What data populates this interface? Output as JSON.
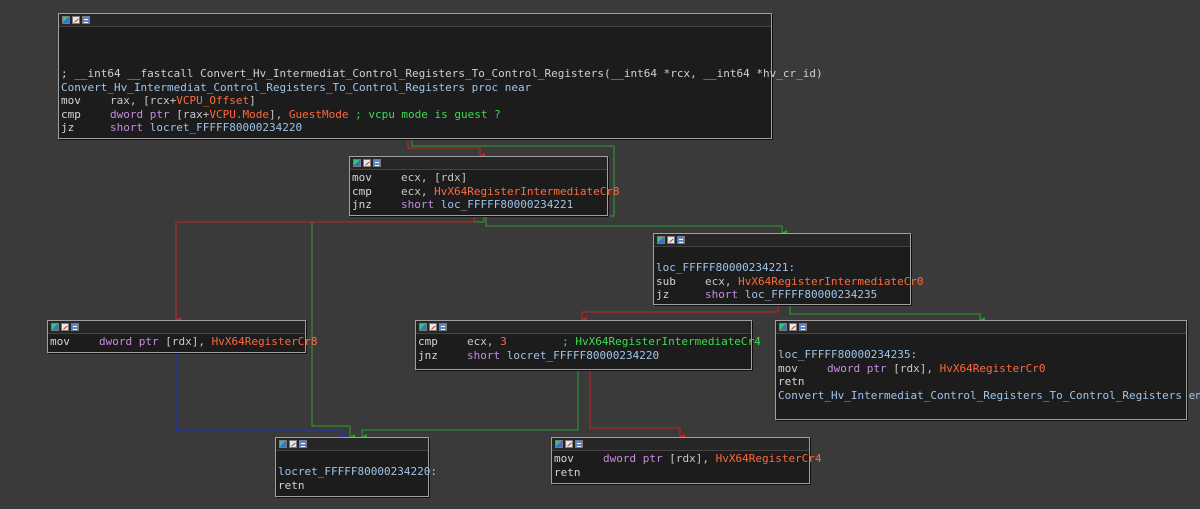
{
  "colors": {
    "background": "#3a3a3a",
    "node_bg": "#1c1c1c",
    "edge_true": "#2e9d2e",
    "edge_false": "#cc2222",
    "edge_uncond": "#2233cc",
    "symbol_orange": "#ff6a3d",
    "keyword_purple": "#c78be0",
    "comment_green": "#3cdc55",
    "label_blue": "#9fc4e8"
  },
  "header_icons": [
    "graph-overview-icon",
    "edit-node-icon",
    "node-list-icon"
  ],
  "nodes": {
    "entry": {
      "comment": "; __int64 __fastcall Convert_Hv_Intermediat_Control_Registers_To_Control_Registers(__int64 *rcx, __int64 *hv_cr_id)",
      "proc_line": "Convert_Hv_Intermediat_Control_Registers_To_Control_Registers proc near",
      "i1": {
        "mnem": "mov",
        "op_a": "rax, [rcx+",
        "sym": "VCPU_Offset",
        "op_b": "]"
      },
      "i2": {
        "mnem": "cmp",
        "kw": "dword ptr",
        "op_a": " [rax+",
        "sym": "VCPU.Mode",
        "op_b": "], ",
        "sym2": "GuestMode",
        "comment": " ; vcpu mode is guest ?"
      },
      "i3": {
        "mnem": "jz",
        "kw": "short",
        "target": " locret_FFFFF80000234220"
      }
    },
    "check_cr8": {
      "i1": {
        "mnem": "mov",
        "op": "ecx, [rdx]"
      },
      "i2": {
        "mnem": "cmp",
        "op": "ecx, ",
        "sym": "HvX64RegisterIntermediateCr8"
      },
      "i3": {
        "mnem": "jnz",
        "kw": "short",
        "target": " loc_FFFFF80000234221"
      }
    },
    "loc_221": {
      "label": "loc_FFFFF80000234221:",
      "i1": {
        "mnem": "sub",
        "op": "ecx, ",
        "sym": "HvX64RegisterIntermediateCr0"
      },
      "i2": {
        "mnem": "jz",
        "kw": "short",
        "target": " loc_FFFFF80000234235"
      }
    },
    "set_cr8": {
      "i1": {
        "mnem": "mov",
        "kw": "dword ptr",
        "op": " [rdx], ",
        "sym": "HvX64RegisterCr8"
      }
    },
    "check_cr4": {
      "i1": {
        "mnem": "cmp",
        "op": "ecx, ",
        "num": "3",
        "comment": "; HvX64RegisterIntermediateCr4"
      },
      "i2": {
        "mnem": "jnz",
        "kw": "short",
        "target": " locret_FFFFF80000234220"
      }
    },
    "loc_235": {
      "label": "loc_FFFFF80000234235:",
      "i1": {
        "mnem": "mov",
        "kw": "dword ptr",
        "op": " [rdx], ",
        "sym": "HvX64RegisterCr0"
      },
      "i2": {
        "mnem": "retn"
      },
      "endp": "Convert_Hv_Intermediat_Control_Registers_To_Control_Registers endp"
    },
    "locret_220": {
      "label": "locret_FFFFF80000234220:",
      "i1": {
        "mnem": "retn"
      }
    },
    "set_cr4": {
      "i1": {
        "mnem": "mov",
        "kw": "dword ptr",
        "op": " [rdx], ",
        "sym": "HvX64RegisterCr4"
      },
      "i2": {
        "mnem": "retn"
      }
    }
  }
}
